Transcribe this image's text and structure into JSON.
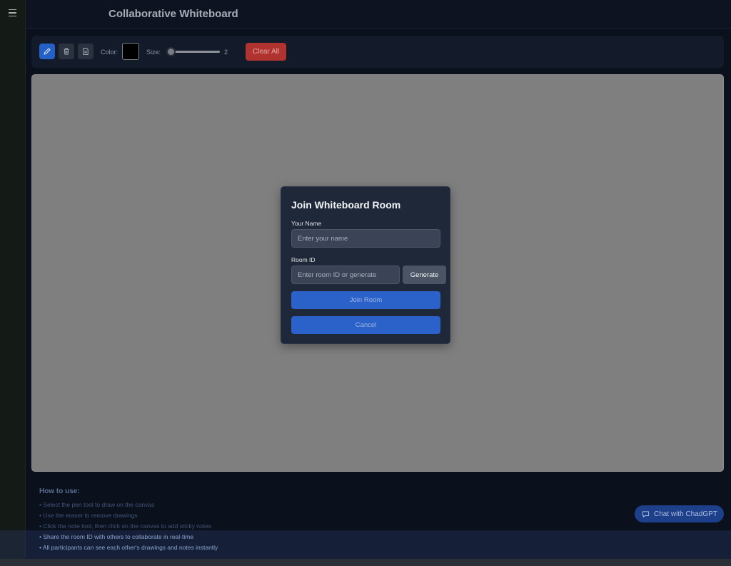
{
  "app": {
    "title": "Collaborative Whiteboard"
  },
  "toolbar": {
    "tools": [
      {
        "name": "pen-tool",
        "icon": "pencil-icon",
        "active": true
      },
      {
        "name": "eraser-tool",
        "icon": "trash-icon",
        "active": false
      },
      {
        "name": "note-tool",
        "icon": "note-icon",
        "active": false
      }
    ],
    "color_label": "Color:",
    "color_value": "#000000",
    "size_label": "Size:",
    "size_value": "2",
    "clear_label": "Clear All"
  },
  "modal": {
    "title": "Join Whiteboard Room",
    "name_label": "Your Name",
    "name_placeholder": "Enter your name",
    "room_label": "Room ID",
    "room_placeholder": "Enter room ID or generate",
    "generate_label": "Generate",
    "join_label": "Join Room",
    "cancel_label": "Cancel"
  },
  "howto": {
    "title": "How to use:",
    "items": [
      "• Select the pen tool to draw on the canvas",
      "• Use the eraser to remove drawings",
      "• Click the note tool, then click on the canvas to add sticky notes",
      "• Share the room ID with others to collaborate in real-time",
      "• All participants can see each other's drawings and notes instantly"
    ]
  },
  "chat": {
    "label": "Chat with ChadGPT"
  },
  "colors": {
    "accent": "#2b62c9",
    "danger": "#b1332f",
    "canvas": "#7f7f7f"
  }
}
